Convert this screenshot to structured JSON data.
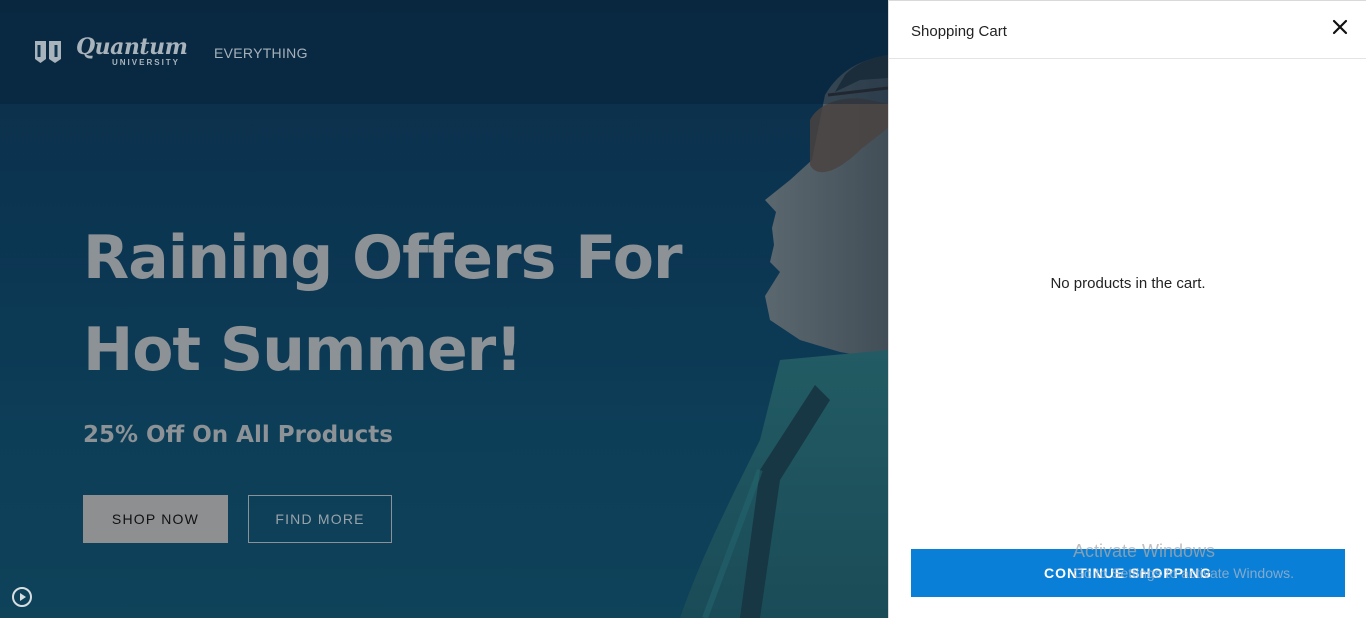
{
  "header": {
    "logo_word": "Quantum",
    "logo_sub": "UNIVERSITY",
    "nav_everything": "EVERYTHING"
  },
  "hero": {
    "title_line1": "Raining Offers For",
    "title_line2": "Hot Summer!",
    "subtitle": "25% Off On All Products",
    "shop_now": "SHOP NOW",
    "find_more": "FIND MORE"
  },
  "cart": {
    "title": "Shopping Cart",
    "empty_message": "No products in the cart.",
    "continue_label": "CONTINUE SHOPPING",
    "accent": "#0a7fd7"
  },
  "watermark": {
    "line1": "Activate Windows",
    "line2": "Go to Settings to activate Windows."
  },
  "icons": {
    "logo": "shield-logo-icon",
    "close": "close-icon",
    "play": "play-icon"
  }
}
